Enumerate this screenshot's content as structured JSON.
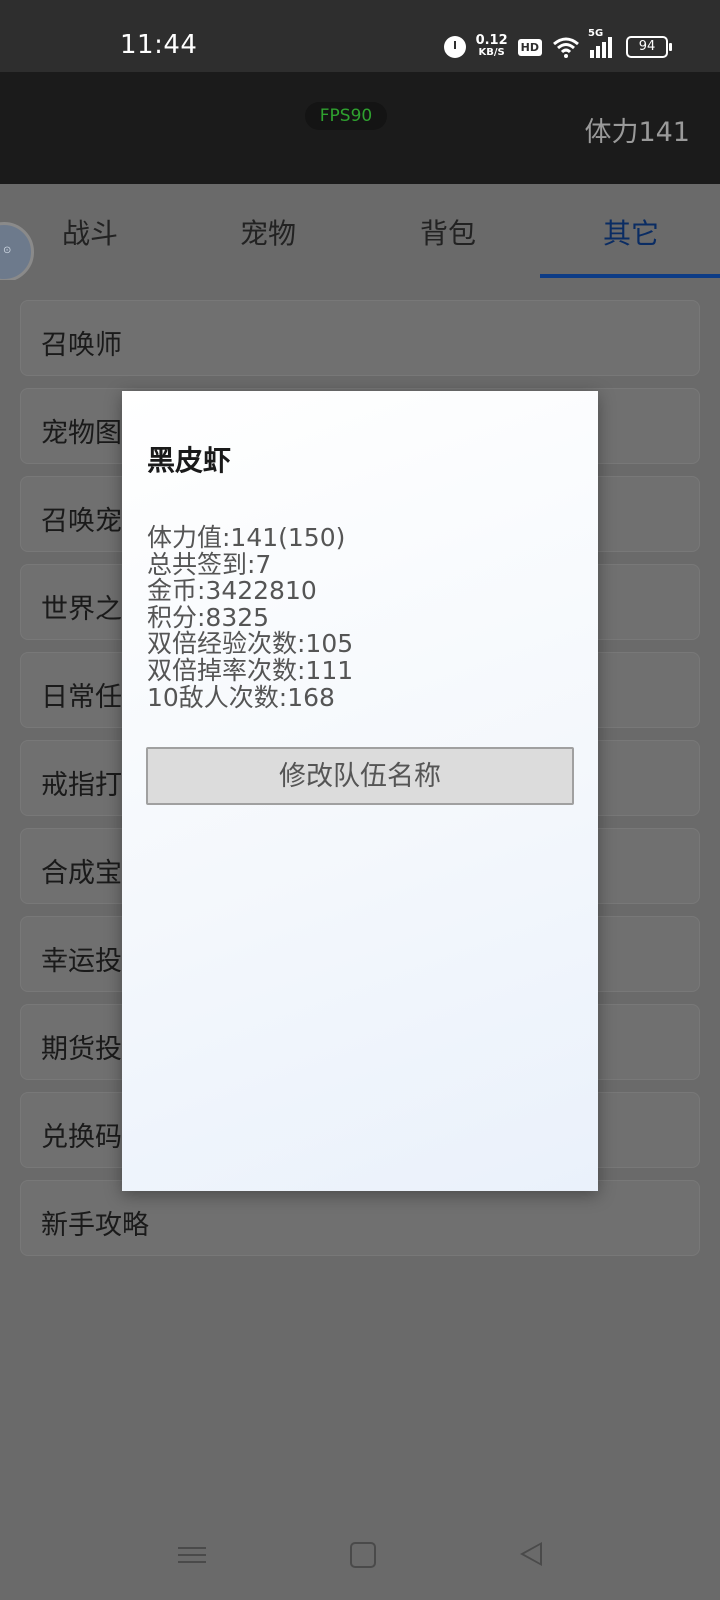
{
  "status_bar": {
    "time": "11:44",
    "net_speed_value": "0.12",
    "net_speed_unit": "KB/S",
    "hd_label": "HD",
    "signal_label": "5G",
    "battery": "94"
  },
  "header": {
    "fps": "FPS90",
    "stamina": "体力141"
  },
  "tabs": [
    {
      "label": "战斗",
      "active": false
    },
    {
      "label": "宠物",
      "active": false
    },
    {
      "label": "背包",
      "active": false
    },
    {
      "label": "其它",
      "active": true
    }
  ],
  "menu_items": [
    "召唤师",
    "宠物图",
    "召唤宠",
    "世界之",
    "日常任",
    "戒指打",
    "合成宝",
    "幸运投",
    "期货投",
    "兑换码",
    "新手攻略"
  ],
  "dialog": {
    "title": "黑皮虾",
    "stats": [
      "体力值:141(150)",
      "总共签到:7",
      "金币:3422810",
      "积分:8325",
      "双倍经验次数:105",
      "双倍掉率次数:111",
      "10敌人次数:168"
    ],
    "rename_button": "修改队伍名称"
  },
  "colors": {
    "active_tab": "#0d3c86",
    "fps_text": "#2fa12f"
  }
}
